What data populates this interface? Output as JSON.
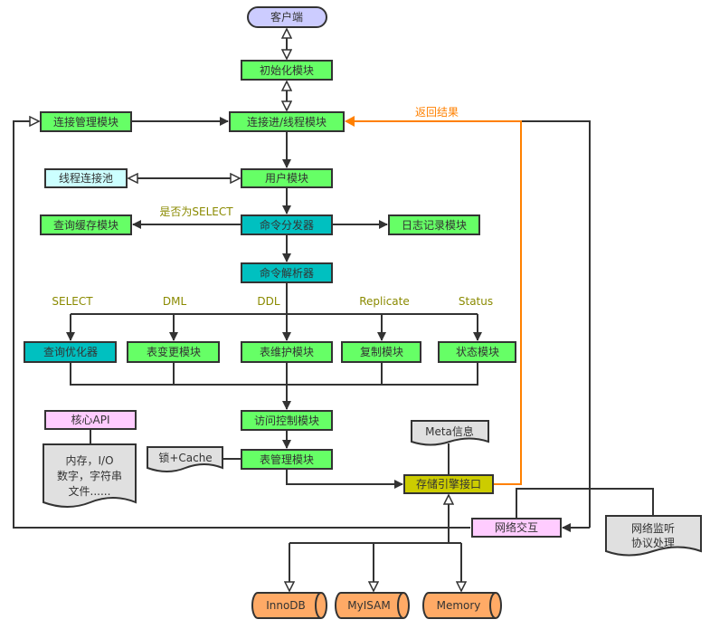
{
  "colors": {
    "module_green": "#66ff66",
    "dispatcher_teal": "#00c0c0",
    "client_lavender": "#ccccff",
    "pool_cyan": "#ccffff",
    "api_pink": "#ffccff",
    "storage_iface_olive": "#cccc00",
    "engine_orange": "#ffaa66",
    "doc_gray": "#e0e0e0",
    "return_line_orange": "#ff8000",
    "label_olive": "#8a8a00"
  },
  "nodes": {
    "client": "客户端",
    "init": "初始化模块",
    "conn_mgmt": "连接管理模块",
    "conn_thread": "连接进/线程模块",
    "thread_pool": "线程连接池",
    "user": "用户模块",
    "query_cache": "查询缓存模块",
    "dispatcher": "命令分发器",
    "logging": "日志记录模块",
    "parser": "命令解析器",
    "optimizer": "查询优化器",
    "table_change": "表变更模块",
    "table_maint": "表维护模块",
    "replication": "复制模块",
    "status": "状态模块",
    "access_control": "访问控制模块",
    "table_mgmt": "表管理模块",
    "lock_cache": "锁+Cache",
    "core_api": "核心API",
    "core_api_doc": [
      "内存，I/O",
      "数字，字符串",
      "文件......"
    ],
    "meta": "Meta信息",
    "storage_iface": "存储引擎接口",
    "network": "网络交互",
    "net_listen": [
      "网络监听",
      "协议处理"
    ],
    "engines": [
      "InnoDB",
      "MyISAM",
      "Memory"
    ]
  },
  "labels": {
    "is_select": "是否为SELECT",
    "return_result": "返回结果",
    "branches": [
      "SELECT",
      "DML",
      "DDL",
      "Replicate",
      "Status"
    ]
  }
}
